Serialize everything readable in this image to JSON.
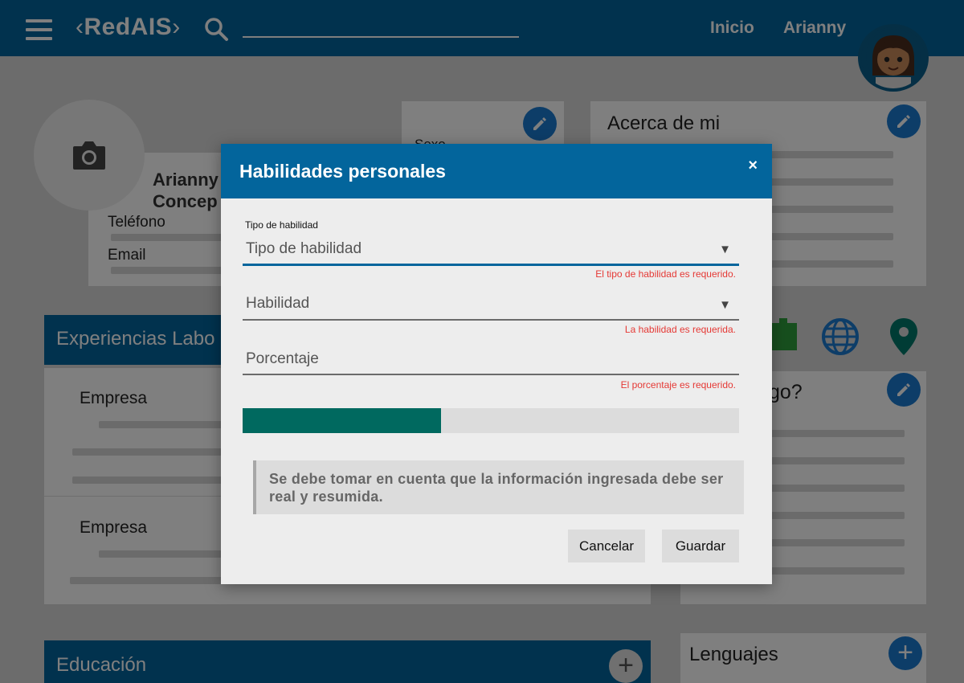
{
  "header": {
    "logo_left": "‹",
    "logo_text": "RedAIS",
    "logo_right": "›",
    "nav_home": "Inicio",
    "nav_user": "Arianny"
  },
  "profile": {
    "name_line1": "Arianny",
    "name_line2": "Concep",
    "phone_label": "Teléfono",
    "email_label": "Email",
    "sex_label": "Sexo"
  },
  "about": {
    "title": "Acerca de mi"
  },
  "experiences": {
    "title": "Experiencias Labo",
    "company_label_1": "Empresa",
    "company_label_2": "Empresa"
  },
  "hobby": {
    "title_fragment": "go?"
  },
  "education": {
    "title": "Educación"
  },
  "languages": {
    "title": "Lenguajes"
  },
  "modal": {
    "title": "Habilidades personales",
    "close": "×",
    "skill_type": {
      "floating_label": "Tipo de habilidad",
      "placeholder": "Tipo de habilidad",
      "error": "El tipo de habilidad es requerido."
    },
    "skill": {
      "placeholder": "Habilidad",
      "error": "La habilidad es requerida."
    },
    "percentage": {
      "placeholder": "Porcentaje",
      "error": "El porcentaje es requerido."
    },
    "progress_percent": 40,
    "notice": "Se debe tomar en cuenta que la información ingresada debe ser real y resumida.",
    "cancel_label": "Cancelar",
    "save_label": "Guardar"
  },
  "colors": {
    "primary": "#03659c",
    "accent": "#1b7bd1",
    "progress": "#00695f",
    "error": "#e53935"
  }
}
